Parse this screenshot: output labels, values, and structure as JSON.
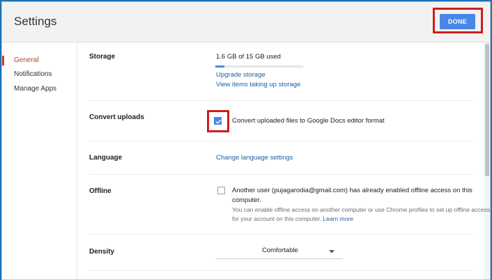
{
  "header": {
    "title": "Settings",
    "done_label": "DONE"
  },
  "sidebar": {
    "items": [
      {
        "label": "General",
        "active": true
      },
      {
        "label": "Notifications",
        "active": false
      },
      {
        "label": "Manage Apps",
        "active": false
      }
    ]
  },
  "storage": {
    "label": "Storage",
    "usage_text": "1.6 GB of 15 GB used",
    "used_fraction": 0.107,
    "upgrade_link": "Upgrade storage",
    "view_items_link": "View items taking up storage"
  },
  "convert_uploads": {
    "label": "Convert uploads",
    "checkbox_text": "Convert uploaded files to Google Docs editor format",
    "checked": true
  },
  "language": {
    "label": "Language",
    "link": "Change language settings"
  },
  "offline": {
    "label": "Offline",
    "checkbox_text_line1": "Another user (pujagarodia@gmail.com) has already enabled offline access on this",
    "checkbox_text_line2": "computer.",
    "description": "You can enable offline access on another computer or use Chrome profiles to set up offline access for your account on this computer.",
    "learn_more": "Learn more",
    "checked": false
  },
  "density": {
    "label": "Density",
    "value": "Comfortable"
  },
  "colors": {
    "accent": "#4a86e8",
    "highlight": "#d01c1c",
    "link": "#1a5fa5",
    "active_nav": "#c0392b"
  }
}
